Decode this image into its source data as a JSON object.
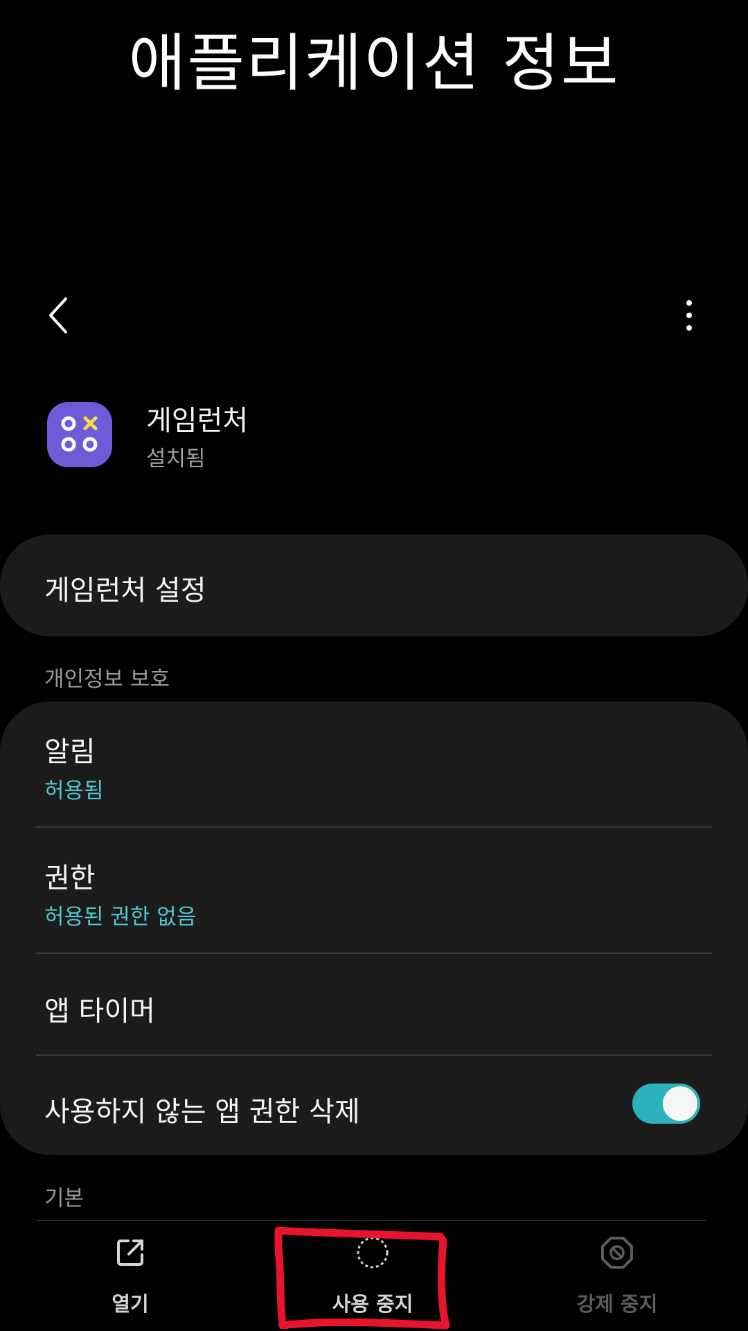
{
  "header": {
    "title": "애플리케이션 정보"
  },
  "app": {
    "name": "게임런처",
    "status": "설치됨"
  },
  "settings_row": {
    "label": "게임런처 설정"
  },
  "privacy": {
    "section_title": "개인정보 보호",
    "rows": [
      {
        "title": "알림",
        "subtitle": "허용됨"
      },
      {
        "title": "권한",
        "subtitle": "허용된 권한 없음"
      },
      {
        "title": "앱 타이머"
      },
      {
        "title": "사용하지 않는 앱 권한 삭제",
        "toggle_on": true
      }
    ]
  },
  "basic": {
    "section_title": "기본"
  },
  "bottom_nav": {
    "items": [
      {
        "label": "열기",
        "icon": "open-external-icon",
        "enabled": true
      },
      {
        "label": "사용 중지",
        "icon": "disable-icon",
        "enabled": true
      },
      {
        "label": "강제 중지",
        "icon": "force-stop-icon",
        "enabled": false
      }
    ]
  },
  "colors": {
    "background": "#000000",
    "card": "#1b1b1b",
    "accent_text": "#52c6d2",
    "toggle_on": "#2bb2bc",
    "app_icon": "#6f5bd8",
    "annotation": "#e8142d"
  }
}
